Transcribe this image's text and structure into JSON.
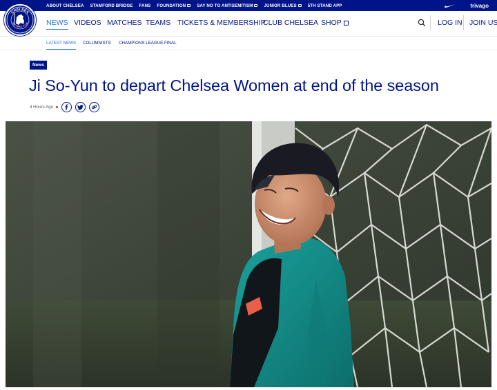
{
  "topbar": {
    "links": [
      {
        "label": "ABOUT CHELSEA",
        "external": false
      },
      {
        "label": "STAMFORD BRIDGE",
        "external": false
      },
      {
        "label": "FANS",
        "external": false
      },
      {
        "label": "FOUNDATION",
        "external": true
      },
      {
        "label": "SAY NO TO ANTISEMITISM",
        "external": true
      },
      {
        "label": "JUNIOR BLUES",
        "external": true
      },
      {
        "label": "5TH STAND APP",
        "external": false
      }
    ],
    "sponsor_brand": "nike-swoosh",
    "sponsor_text": "trivago"
  },
  "crest": {
    "text_top": "CHELSEA",
    "text_bottom": "FOOTBALL CLUB"
  },
  "mainnav": {
    "items": [
      {
        "label": "NEWS",
        "active": true
      },
      {
        "label": "VIDEOS",
        "active": false
      },
      {
        "label": "MATCHES",
        "active": false
      },
      {
        "label": "TEAMS",
        "active": false
      },
      {
        "label": "TICKETS & MEMBERSHIP",
        "active": false
      },
      {
        "label": "CLUB CHELSEA",
        "active": false
      },
      {
        "label": "SHOP",
        "active": false
      }
    ],
    "login": "LOG IN",
    "join": "JOIN US"
  },
  "subnav": {
    "items": [
      {
        "label": "LATEST NEWS",
        "active": true
      },
      {
        "label": "COLUMNISTS",
        "active": false
      },
      {
        "label": "CHAMPIONS LEAGUE FINAL",
        "active": false
      }
    ]
  },
  "article": {
    "category": "News",
    "headline": "Ji So-Yun to depart Chelsea Women at end of the season",
    "time": "4 Hours Ago",
    "share_icons": [
      "facebook-icon",
      "twitter-icon",
      "link-icon"
    ]
  },
  "colors": {
    "brand_blue": "#001489",
    "accent_blue": "#1c6fd1",
    "pitch_green": "#3f4a3a",
    "kit_teal": "#148a86"
  }
}
